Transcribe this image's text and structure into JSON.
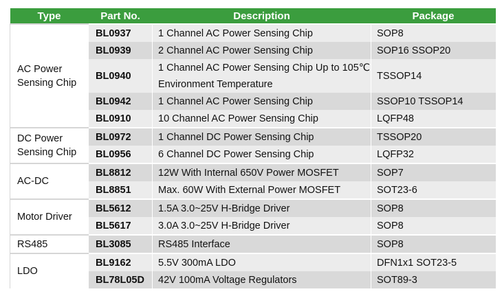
{
  "table": {
    "headers": {
      "type": "Type",
      "part_no": "Part No.",
      "description": "Description",
      "package": "Package"
    },
    "groups": [
      {
        "type": "AC Power Sensing Chip",
        "rows": [
          {
            "part": "BL0937",
            "desc": "1 Channel AC Power Sensing Chip",
            "pkg": "SOP8"
          },
          {
            "part": "BL0939",
            "desc": "2 Channel AC Power Sensing Chip",
            "pkg": "SOP16 SSOP20"
          },
          {
            "part": "BL0940",
            "desc": "1 Channel AC Power Sensing Chip Up to 105℃ Environment Temperature",
            "pkg": "TSSOP14"
          },
          {
            "part": "BL0942",
            "desc": "1 Channel AC Power Sensing Chip",
            "pkg": "SSOP10 TSSOP14"
          },
          {
            "part": "BL0910",
            "desc": "10 Channel AC Power Sensing Chip",
            "pkg": "LQFP48"
          }
        ]
      },
      {
        "type": "DC Power Sensing Chip",
        "rows": [
          {
            "part": "BL0972",
            "desc": "1 Channel DC Power Sensing Chip",
            "pkg": "TSSOP20"
          },
          {
            "part": "BL0956",
            "desc": "6 Channel DC Power Sensing Chip",
            "pkg": "LQFP32"
          }
        ]
      },
      {
        "type": "AC-DC",
        "rows": [
          {
            "part": "BL8812",
            "desc": "12W With Internal 650V Power MOSFET",
            "pkg": "SOP7"
          },
          {
            "part": "BL8851",
            "desc": "Max. 60W With External Power MOSFET",
            "pkg": "SOT23-6"
          }
        ]
      },
      {
        "type": "Motor Driver",
        "rows": [
          {
            "part": "BL5612",
            "desc": "1.5A 3.0~25V H-Bridge Driver",
            "pkg": "SOP8"
          },
          {
            "part": "BL5617",
            "desc": "3.0A 3.0~25V H-Bridge Driver",
            "pkg": "SOP8"
          }
        ]
      },
      {
        "type": "RS485",
        "rows": [
          {
            "part": "BL3085",
            "desc": "RS485 Interface",
            "pkg": "SOP8"
          }
        ]
      },
      {
        "type": "LDO",
        "rows": [
          {
            "part": "BL9162",
            "desc": "5.5V 300mA LDO",
            "pkg": "DFN1x1 SOT23-5"
          },
          {
            "part": "BL78L05D",
            "desc": "42V 100mA Voltage Regulators",
            "pkg": "SOT89-3"
          }
        ]
      }
    ]
  }
}
